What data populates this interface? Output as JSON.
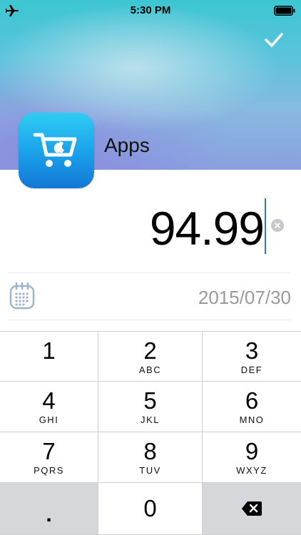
{
  "status_bar": {
    "time": "5:30 PM",
    "airplane_icon": "airplane-icon",
    "battery_icon": "battery-icon"
  },
  "header": {
    "confirm_icon": "checkmark-icon",
    "app_icon": "app-store-cart-icon",
    "app_name": "Apps"
  },
  "amount": {
    "value": "94.99",
    "clear_icon": "clear-icon"
  },
  "date": {
    "calendar_icon": "calendar-icon",
    "value": "2015/07/30"
  },
  "keypad": {
    "keys": [
      {
        "digit": "1",
        "letters": ""
      },
      {
        "digit": "2",
        "letters": "ABC"
      },
      {
        "digit": "3",
        "letters": "DEF"
      },
      {
        "digit": "4",
        "letters": "GHI"
      },
      {
        "digit": "5",
        "letters": "JKL"
      },
      {
        "digit": "6",
        "letters": "MNO"
      },
      {
        "digit": "7",
        "letters": "PQRS"
      },
      {
        "digit": "8",
        "letters": "TUV"
      },
      {
        "digit": "9",
        "letters": "WXYZ"
      }
    ],
    "decimal": ".",
    "zero": "0",
    "delete_icon": "backspace-icon"
  },
  "colors": {
    "accent_cursor": "#2f6fe0",
    "app_icon_top": "#2ecdf3",
    "app_icon_bottom": "#1476d6",
    "date_text": "#9a9a9a",
    "keypad_grey": "#d5d7db"
  }
}
